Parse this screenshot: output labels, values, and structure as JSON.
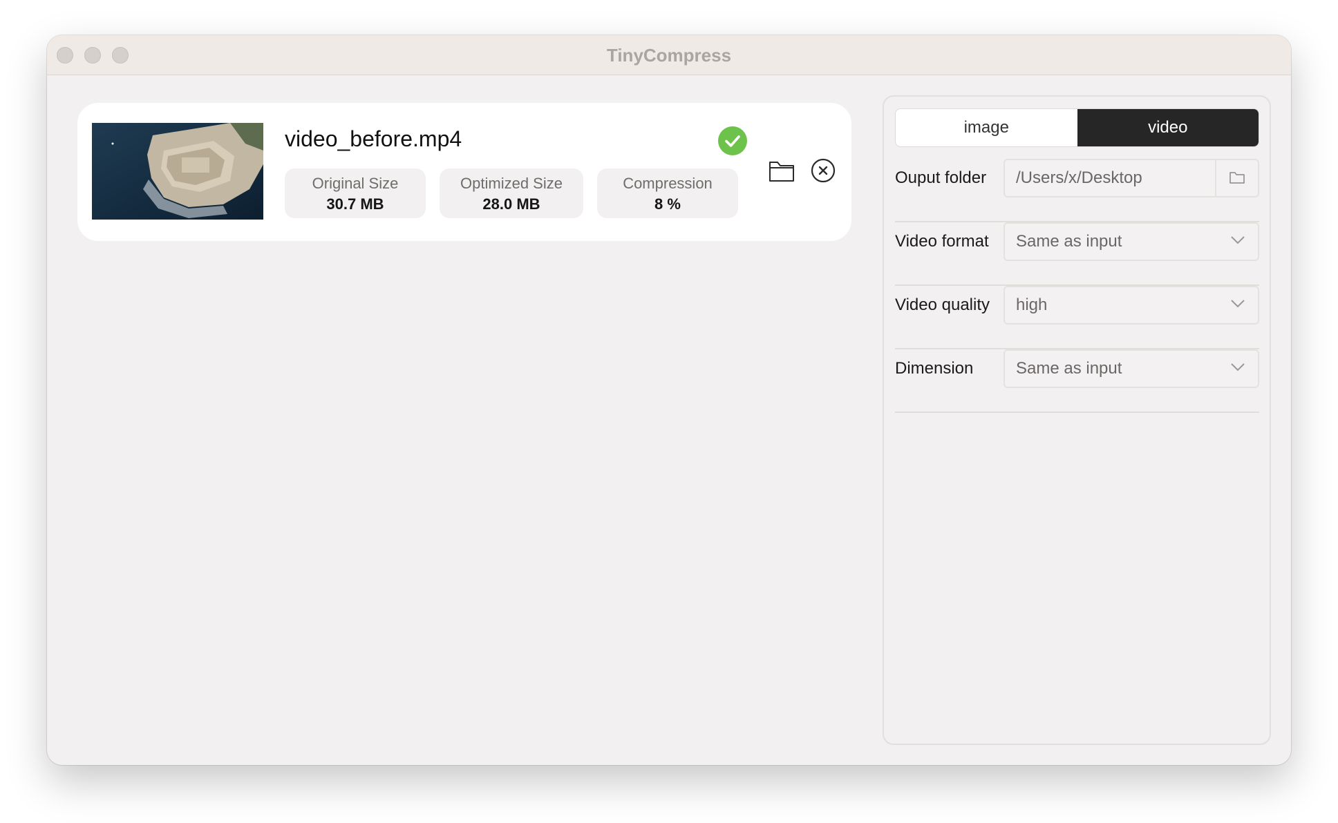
{
  "window": {
    "title": "TinyCompress"
  },
  "file": {
    "name": "video_before.mp4",
    "status": "done",
    "stats": {
      "original_label": "Original Size",
      "original_value": "30.7 MB",
      "optimized_label": "Optimized Size",
      "optimized_value": "28.0 MB",
      "compression_label": "Compression",
      "compression_value": "8 %"
    }
  },
  "settings": {
    "tabs": [
      {
        "label": "image",
        "active": false
      },
      {
        "label": "video",
        "active": true
      }
    ],
    "output_folder": {
      "label": "Ouput folder",
      "value": "/Users/x/Desktop"
    },
    "video_format": {
      "label": "Video format",
      "value": "Same as input"
    },
    "video_quality": {
      "label": "Video quality",
      "value": "high"
    },
    "dimension": {
      "label": "Dimension",
      "value": "Same as input"
    }
  },
  "icons": {
    "status": "check-circle-icon",
    "open_folder": "folder-icon",
    "remove": "close-circle-icon",
    "dropdown": "chevron-down-icon"
  },
  "colors": {
    "success": "#6cc24a",
    "segment_active": "#262626",
    "window_bg": "#f2f0f0",
    "titlebar_bg": "#efeae6"
  }
}
